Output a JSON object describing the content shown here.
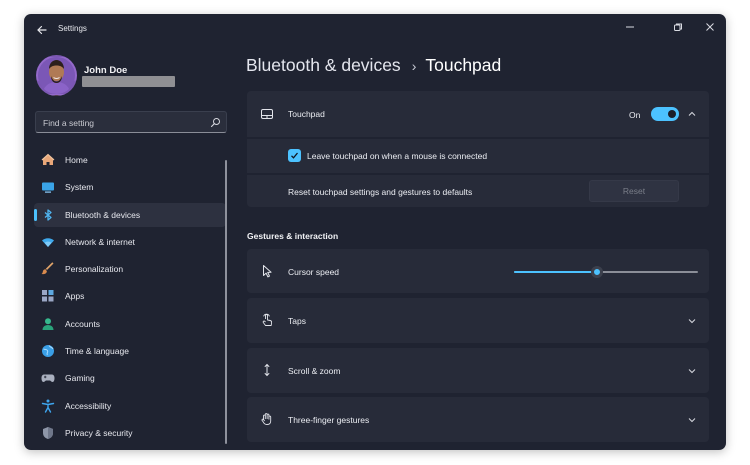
{
  "app": {
    "title": "Settings"
  },
  "user": {
    "name": "John Doe"
  },
  "search": {
    "placeholder": "Find a setting"
  },
  "nav": [
    {
      "label": "Home",
      "icon": "home-icon"
    },
    {
      "label": "System",
      "icon": "system-icon"
    },
    {
      "label": "Bluetooth & devices",
      "icon": "bluetooth-icon",
      "active": true
    },
    {
      "label": "Network & internet",
      "icon": "wifi-icon"
    },
    {
      "label": "Personalization",
      "icon": "brush-icon"
    },
    {
      "label": "Apps",
      "icon": "apps-icon"
    },
    {
      "label": "Accounts",
      "icon": "accounts-icon"
    },
    {
      "label": "Time & language",
      "icon": "globe-icon"
    },
    {
      "label": "Gaming",
      "icon": "gamepad-icon"
    },
    {
      "label": "Accessibility",
      "icon": "accessibility-icon"
    },
    {
      "label": "Privacy & security",
      "icon": "shield-icon"
    }
  ],
  "breadcrumb": {
    "parent": "Bluetooth & devices",
    "separator": "›",
    "current": "Touchpad"
  },
  "touchpad": {
    "label": "Touchpad",
    "toggle_state": "On",
    "toggle_on": true,
    "leave_on_label": "Leave touchpad on when a mouse is connected",
    "leave_on_checked": true,
    "reset_label": "Reset touchpad settings and gestures to defaults",
    "reset_button": "Reset"
  },
  "gestures": {
    "section_title": "Gestures & interaction",
    "cursor_speed_label": "Cursor speed",
    "cursor_speed_value": 0.45,
    "taps_label": "Taps",
    "scroll_zoom_label": "Scroll & zoom",
    "three_finger_label": "Three-finger gestures"
  },
  "colors": {
    "accent": "#4cc2ff",
    "window_bg": "#1f2331",
    "card_bg": "#272b39"
  }
}
